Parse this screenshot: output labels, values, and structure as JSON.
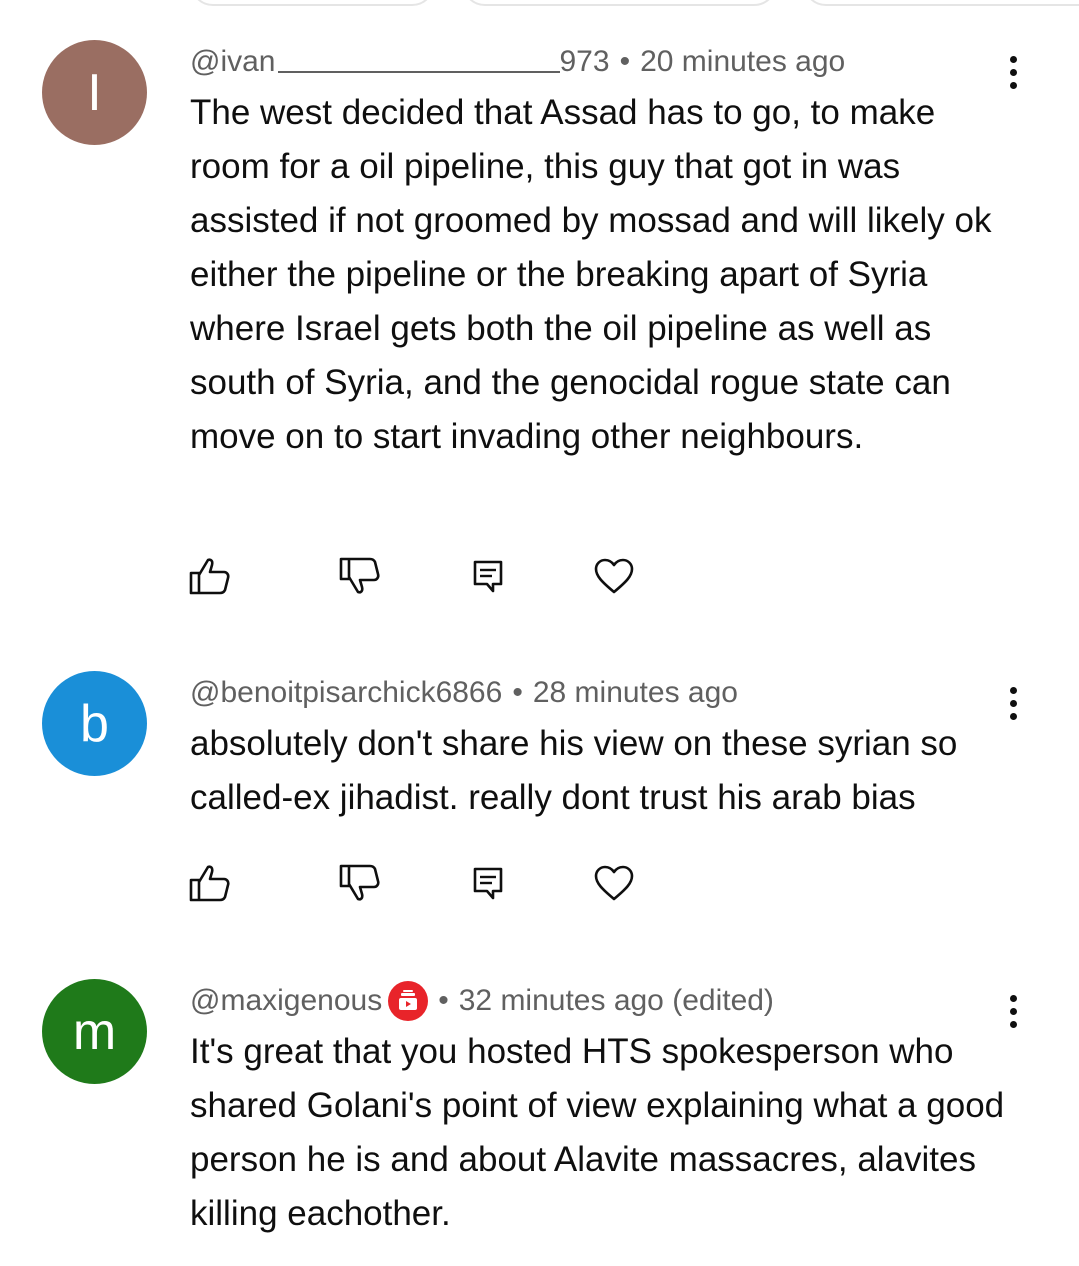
{
  "comments": [
    {
      "avatar_letter": "I",
      "avatar_color": "#9a6e62",
      "handle_start": "@ivan",
      "handle_end": "973",
      "time": "20 minutes ago",
      "text": "The west decided that Assad has to go, to make room for a oil pipeline, this guy that got in was assisted if not groomed by mossad and will likely ok either the pipeline or the breaking apart of Syria where Israel gets both the oil pipeline as well as south of Syria, and the genocidal rogue state can move on to start invading other neighbours."
    },
    {
      "avatar_letter": "b",
      "avatar_color": "#1a8fd8",
      "handle": "@benoitpisarchick6866",
      "time": "28 minutes ago",
      "text": "absolutely don't share his view on these syrian so called-ex jihadist. really dont trust his arab bias"
    },
    {
      "avatar_letter": "m",
      "avatar_color": "#1f7a1a",
      "handle": "@maxigenous",
      "badge": "member-badge-icon",
      "badge_color": "#e8242a",
      "time": "32 minutes ago (edited)",
      "text": "It's great that you hosted HTS spokesperson who shared Golani's point of view explaining what a good person he is and about Alavite massacres, alavites killing eachother."
    }
  ],
  "separator": "•",
  "icons": [
    "like-icon",
    "dislike-icon",
    "reply-icon",
    "heart-icon",
    "more-options-icon"
  ]
}
